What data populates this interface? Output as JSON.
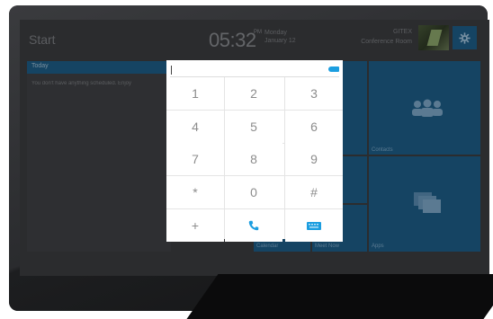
{
  "header": {
    "start_label": "Start",
    "time": "05:32",
    "ampm": "PM",
    "weekday": "Monday",
    "date": "January 12",
    "room_name": "GITEX",
    "room_subtitle": "Conference Room",
    "settings_icon": "gear-icon"
  },
  "today": {
    "label": "Today",
    "message": "You don't have anything scheduled. Enjoy"
  },
  "tiles": {
    "contacts": "Contacts",
    "calendar": "Calendar",
    "meet_now": "Meet Now",
    "apps": "Apps"
  },
  "dialpad": {
    "input_value": "",
    "keys": [
      "1",
      "2",
      "3",
      "4",
      "5",
      "6",
      "7",
      "8",
      "9",
      "*",
      "0",
      "#",
      "+"
    ],
    "call_icon": "phone-icon",
    "keyboard_icon": "keyboard-icon",
    "backspace_icon": "backspace-icon"
  },
  "colors": {
    "tile_blue": "#1e5f89",
    "accent": "#1c9ee0"
  }
}
